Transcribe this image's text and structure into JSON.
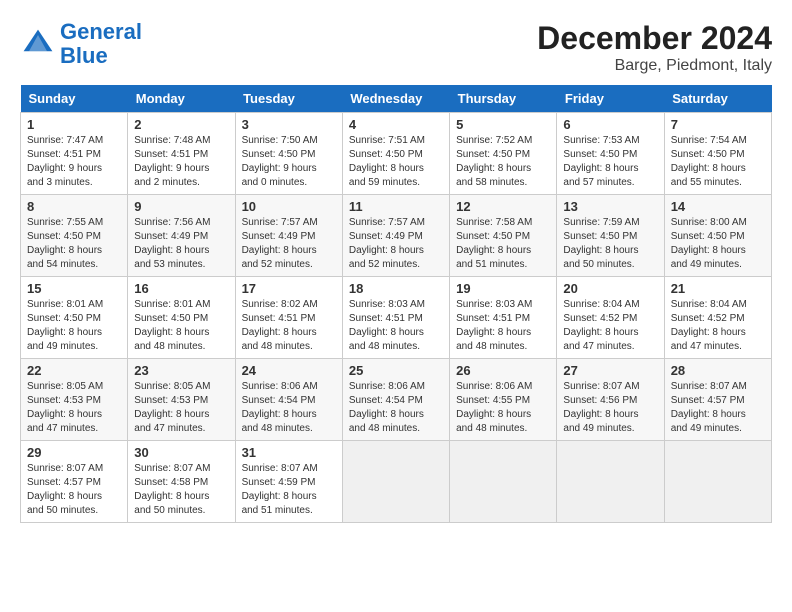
{
  "header": {
    "logo_line1": "General",
    "logo_line2": "Blue",
    "title": "December 2024",
    "subtitle": "Barge, Piedmont, Italy"
  },
  "weekdays": [
    "Sunday",
    "Monday",
    "Tuesday",
    "Wednesday",
    "Thursday",
    "Friday",
    "Saturday"
  ],
  "weeks": [
    [
      {
        "day": "1",
        "info": "Sunrise: 7:47 AM\nSunset: 4:51 PM\nDaylight: 9 hours and 3 minutes."
      },
      {
        "day": "2",
        "info": "Sunrise: 7:48 AM\nSunset: 4:51 PM\nDaylight: 9 hours and 2 minutes."
      },
      {
        "day": "3",
        "info": "Sunrise: 7:50 AM\nSunset: 4:50 PM\nDaylight: 9 hours and 0 minutes."
      },
      {
        "day": "4",
        "info": "Sunrise: 7:51 AM\nSunset: 4:50 PM\nDaylight: 8 hours and 59 minutes."
      },
      {
        "day": "5",
        "info": "Sunrise: 7:52 AM\nSunset: 4:50 PM\nDaylight: 8 hours and 58 minutes."
      },
      {
        "day": "6",
        "info": "Sunrise: 7:53 AM\nSunset: 4:50 PM\nDaylight: 8 hours and 57 minutes."
      },
      {
        "day": "7",
        "info": "Sunrise: 7:54 AM\nSunset: 4:50 PM\nDaylight: 8 hours and 55 minutes."
      }
    ],
    [
      {
        "day": "8",
        "info": "Sunrise: 7:55 AM\nSunset: 4:50 PM\nDaylight: 8 hours and 54 minutes."
      },
      {
        "day": "9",
        "info": "Sunrise: 7:56 AM\nSunset: 4:49 PM\nDaylight: 8 hours and 53 minutes."
      },
      {
        "day": "10",
        "info": "Sunrise: 7:57 AM\nSunset: 4:49 PM\nDaylight: 8 hours and 52 minutes."
      },
      {
        "day": "11",
        "info": "Sunrise: 7:57 AM\nSunset: 4:49 PM\nDaylight: 8 hours and 52 minutes."
      },
      {
        "day": "12",
        "info": "Sunrise: 7:58 AM\nSunset: 4:50 PM\nDaylight: 8 hours and 51 minutes."
      },
      {
        "day": "13",
        "info": "Sunrise: 7:59 AM\nSunset: 4:50 PM\nDaylight: 8 hours and 50 minutes."
      },
      {
        "day": "14",
        "info": "Sunrise: 8:00 AM\nSunset: 4:50 PM\nDaylight: 8 hours and 49 minutes."
      }
    ],
    [
      {
        "day": "15",
        "info": "Sunrise: 8:01 AM\nSunset: 4:50 PM\nDaylight: 8 hours and 49 minutes."
      },
      {
        "day": "16",
        "info": "Sunrise: 8:01 AM\nSunset: 4:50 PM\nDaylight: 8 hours and 48 minutes."
      },
      {
        "day": "17",
        "info": "Sunrise: 8:02 AM\nSunset: 4:51 PM\nDaylight: 8 hours and 48 minutes."
      },
      {
        "day": "18",
        "info": "Sunrise: 8:03 AM\nSunset: 4:51 PM\nDaylight: 8 hours and 48 minutes."
      },
      {
        "day": "19",
        "info": "Sunrise: 8:03 AM\nSunset: 4:51 PM\nDaylight: 8 hours and 48 minutes."
      },
      {
        "day": "20",
        "info": "Sunrise: 8:04 AM\nSunset: 4:52 PM\nDaylight: 8 hours and 47 minutes."
      },
      {
        "day": "21",
        "info": "Sunrise: 8:04 AM\nSunset: 4:52 PM\nDaylight: 8 hours and 47 minutes."
      }
    ],
    [
      {
        "day": "22",
        "info": "Sunrise: 8:05 AM\nSunset: 4:53 PM\nDaylight: 8 hours and 47 minutes."
      },
      {
        "day": "23",
        "info": "Sunrise: 8:05 AM\nSunset: 4:53 PM\nDaylight: 8 hours and 47 minutes."
      },
      {
        "day": "24",
        "info": "Sunrise: 8:06 AM\nSunset: 4:54 PM\nDaylight: 8 hours and 48 minutes."
      },
      {
        "day": "25",
        "info": "Sunrise: 8:06 AM\nSunset: 4:54 PM\nDaylight: 8 hours and 48 minutes."
      },
      {
        "day": "26",
        "info": "Sunrise: 8:06 AM\nSunset: 4:55 PM\nDaylight: 8 hours and 48 minutes."
      },
      {
        "day": "27",
        "info": "Sunrise: 8:07 AM\nSunset: 4:56 PM\nDaylight: 8 hours and 49 minutes."
      },
      {
        "day": "28",
        "info": "Sunrise: 8:07 AM\nSunset: 4:57 PM\nDaylight: 8 hours and 49 minutes."
      }
    ],
    [
      {
        "day": "29",
        "info": "Sunrise: 8:07 AM\nSunset: 4:57 PM\nDaylight: 8 hours and 50 minutes."
      },
      {
        "day": "30",
        "info": "Sunrise: 8:07 AM\nSunset: 4:58 PM\nDaylight: 8 hours and 50 minutes."
      },
      {
        "day": "31",
        "info": "Sunrise: 8:07 AM\nSunset: 4:59 PM\nDaylight: 8 hours and 51 minutes."
      },
      null,
      null,
      null,
      null
    ]
  ]
}
